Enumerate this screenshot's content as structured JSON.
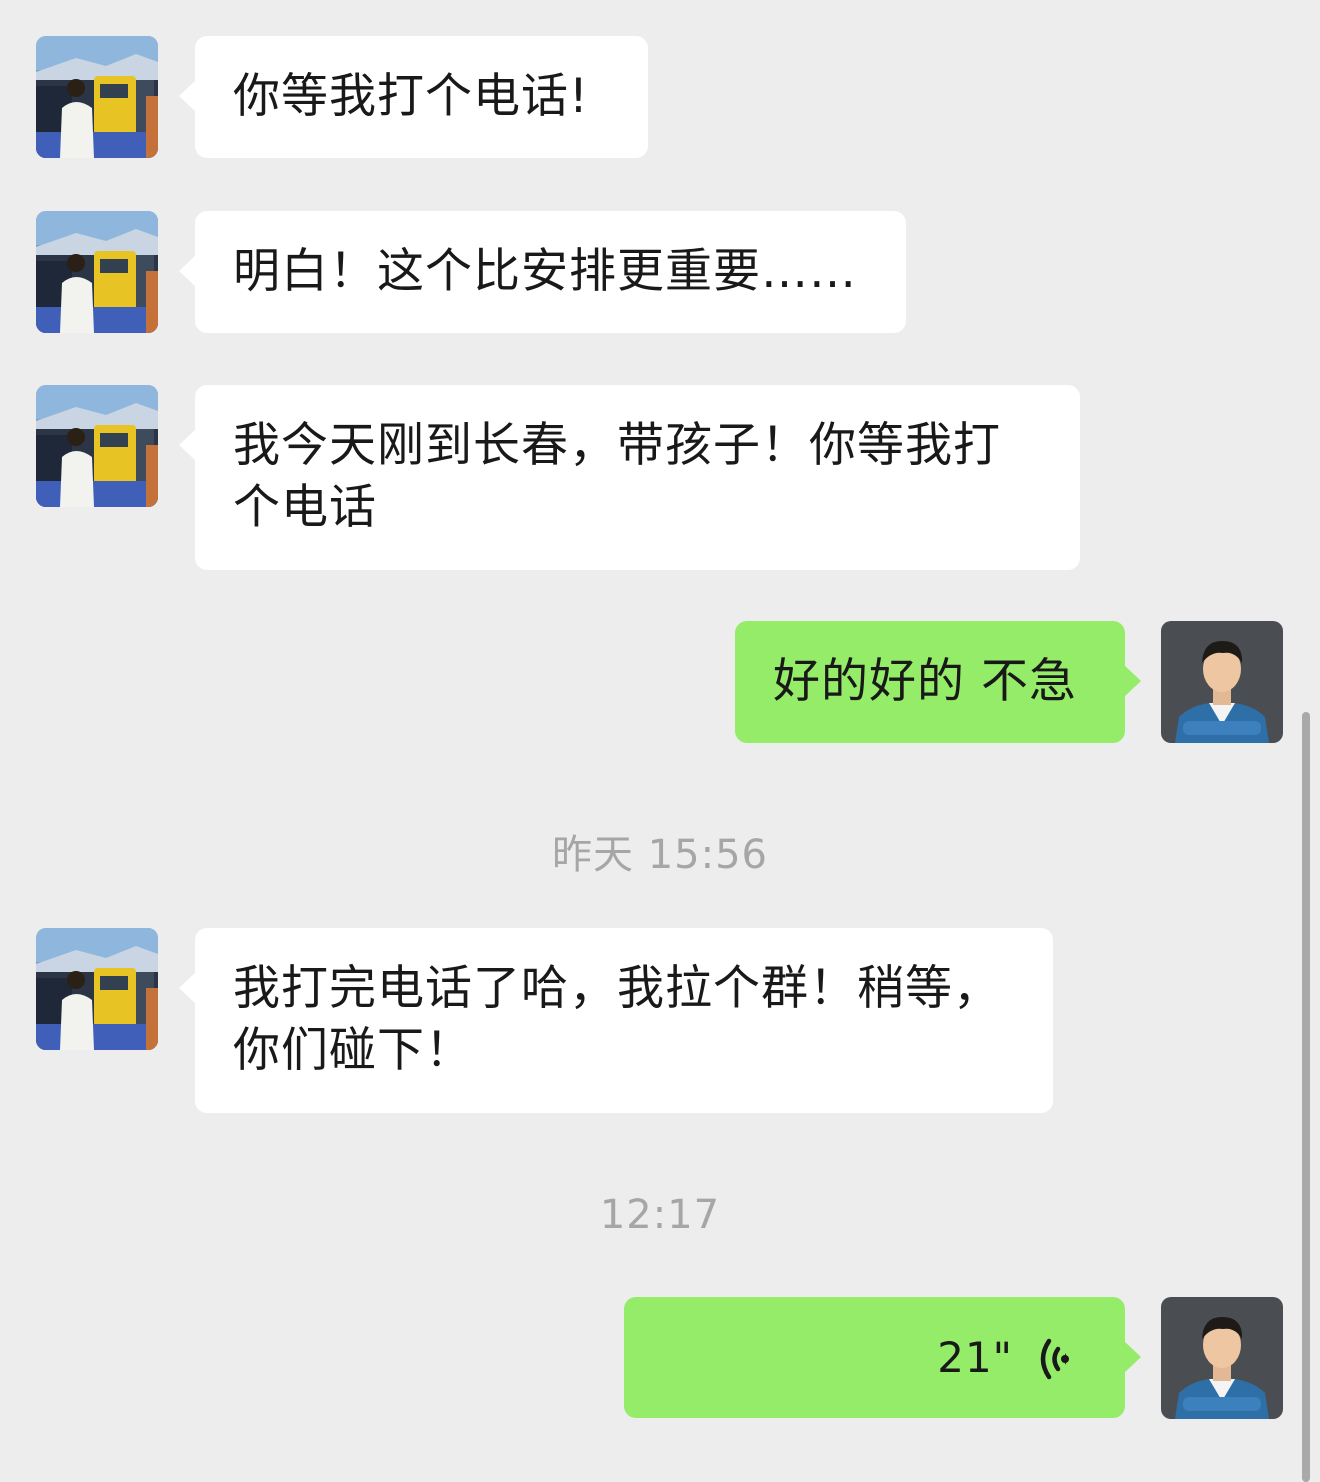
{
  "messages": [
    {
      "sender": "contact",
      "text": "你等我打个电话!"
    },
    {
      "sender": "contact",
      "text": "明白！这个比安排更重要……"
    },
    {
      "sender": "contact",
      "text": "我今天刚到长春，带孩子！你等我打个电话"
    },
    {
      "sender": "me",
      "text": "好的好的 不急"
    },
    {
      "sender": "contact",
      "text": "我打完电话了哈，我拉个群！稍等，你们碰下！"
    },
    {
      "sender": "me",
      "type": "voice",
      "duration": "21\""
    }
  ],
  "timestamps": [
    "昨天 15:56",
    "12:17"
  ],
  "icons": {
    "contact_avatar": "contact-avatar-photo",
    "my_avatar": "my-avatar-photo",
    "voice": "voice-wave-icon"
  },
  "colors": {
    "background": "#ededed",
    "incoming_bubble": "#ffffff",
    "outgoing_bubble": "#95ec69",
    "timestamp": "#a6a6a6"
  }
}
